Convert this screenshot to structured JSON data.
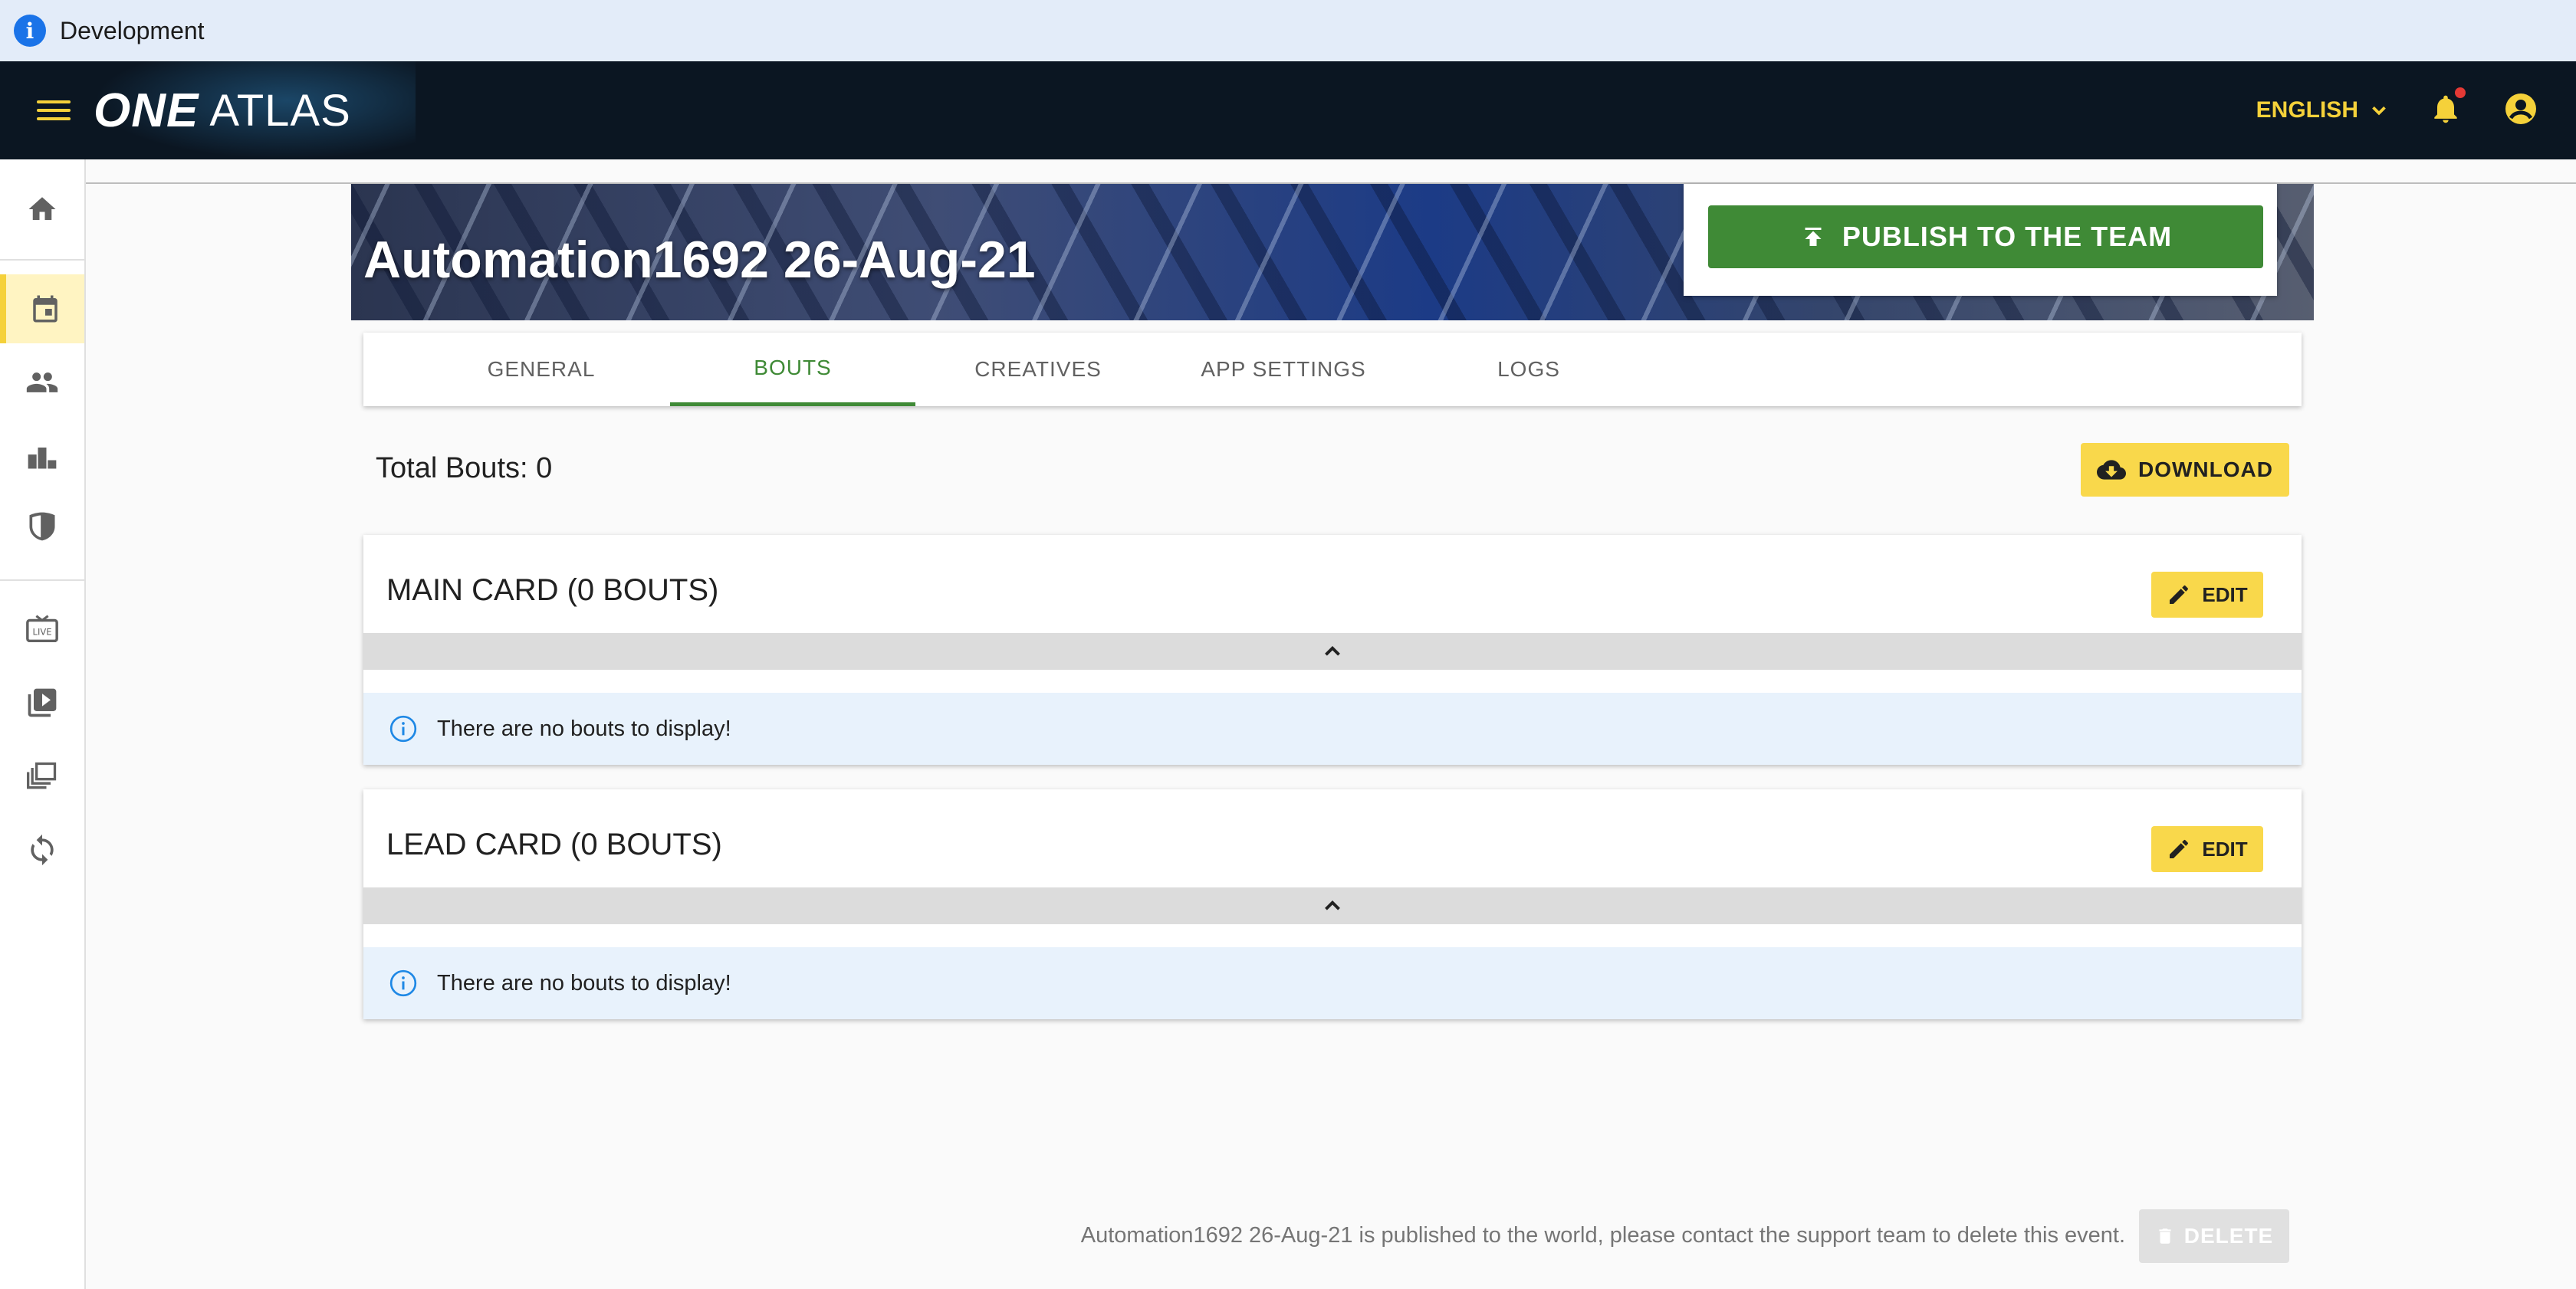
{
  "env_banner": {
    "text": "Development",
    "icon": "info-icon"
  },
  "app_bar": {
    "logo_one": "ONE",
    "logo_atlas": "ATLAS",
    "language": "ENGLISH",
    "icons": [
      "menu-icon",
      "chevron-down-icon",
      "bell-icon",
      "account-circle-icon"
    ]
  },
  "side_rail": {
    "items": [
      {
        "icon": "home-icon"
      },
      {
        "icon": "calendar-icon",
        "active": true
      },
      {
        "icon": "people-icon"
      },
      {
        "icon": "podium-icon"
      },
      {
        "icon": "shield-icon"
      },
      {
        "icon": "live-tv-icon"
      },
      {
        "icon": "video-library-icon"
      },
      {
        "icon": "library-copy-icon"
      },
      {
        "icon": "sync-icon"
      }
    ]
  },
  "hero": {
    "title": "Automation1692 26-Aug-21"
  },
  "publish": {
    "label": "PUBLISH TO THE TEAM",
    "color": "#3f8a36"
  },
  "tabs": [
    {
      "label": "GENERAL"
    },
    {
      "label": "BOUTS",
      "active": true
    },
    {
      "label": "CREATIVES"
    },
    {
      "label": "APP SETTINGS"
    },
    {
      "label": "LOGS"
    }
  ],
  "bouts": {
    "total_label": "Total Bouts: 0",
    "download_label": "DOWNLOAD",
    "cards": [
      {
        "title": "MAIN CARD (0 BOUTS)",
        "edit_label": "EDIT",
        "empty_text": "There are no bouts to display!"
      },
      {
        "title": "LEAD CARD (0 BOUTS)",
        "edit_label": "EDIT",
        "empty_text": "There are no bouts to display!"
      }
    ]
  },
  "footer": {
    "note": "Automation1692 26-Aug-21 is published to the world, please contact the support team to delete this event.",
    "delete_label": "DELETE"
  },
  "colors": {
    "accent": "#f9d84b",
    "primary": "#3f8a36",
    "appbar": "#0b1622",
    "info": "#1a73e8"
  }
}
